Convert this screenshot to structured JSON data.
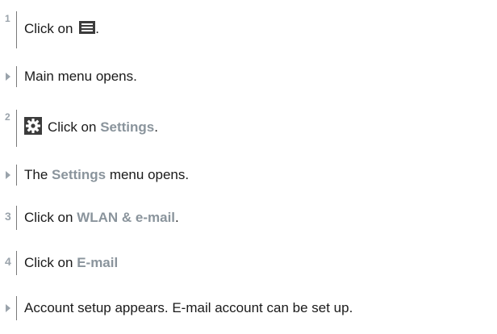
{
  "steps": [
    {
      "marker": "1",
      "parts": [
        "Click on ",
        "."
      ]
    },
    {
      "marker_icon": "arrow-right-icon",
      "text": "Main menu opens."
    },
    {
      "marker": "2",
      "parts": [
        "Click on ",
        "Settings",
        "."
      ]
    },
    {
      "marker_icon": "arrow-right-icon",
      "parts": [
        "The ",
        "Settings",
        " menu opens."
      ]
    },
    {
      "marker": "3",
      "parts": [
        "Click on ",
        "WLAN & e-mail",
        "."
      ]
    },
    {
      "marker": "4",
      "parts": [
        "Click on ",
        "E-mail"
      ]
    },
    {
      "marker_icon": "arrow-right-icon",
      "text": "Account setup appears. E-mail account can be set up."
    }
  ],
  "icons": {
    "step1": "hamburger-menu-icon",
    "step2": "gear-icon"
  },
  "colors": {
    "text": "#1a1a1a",
    "highlight": "#8a949c",
    "marker": "#9aa3ab",
    "icon": "#3c3c3c"
  }
}
